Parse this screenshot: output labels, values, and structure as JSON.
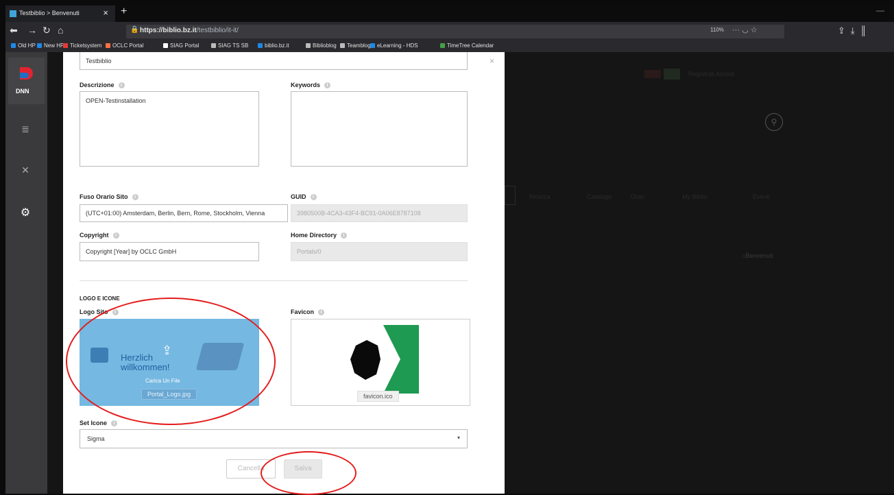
{
  "browser": {
    "tab_title": "Testbiblio > Benvenuti",
    "url_host": "https://biblio.bz.it",
    "url_path": "/testbiblio/it-it/",
    "zoom": "110%",
    "bookmarks": [
      {
        "label": "Old HP",
        "color": "#1e88e5"
      },
      {
        "label": "New HP",
        "color": "#1e88e5"
      },
      {
        "label": "Ticketsystem",
        "color": "#e53935"
      },
      {
        "label": "OCLC Portal",
        "color": "#ff7043"
      },
      {
        "label": "SIAG Portal",
        "color": "#ffffff"
      },
      {
        "label": "SIAG TS SB",
        "color": "#bbbbbb"
      },
      {
        "label": "biblio.bz.it",
        "color": "#1e88e5"
      },
      {
        "label": "Biblioblog",
        "color": "#bbbbbb"
      },
      {
        "label": "Teamblog",
        "color": "#bbbbbb"
      },
      {
        "label": "eLearning - HDS",
        "color": "#1e88e5"
      },
      {
        "label": "TimeTree Calendar",
        "color": "#43a047"
      }
    ]
  },
  "sidebar": {
    "logo_text": "DNN"
  },
  "background": {
    "user_links": "Registrati   Accedi",
    "menu": [
      "Ricerca",
      "Catalogo",
      "Orari",
      "My Biblio",
      "Eventi"
    ],
    "breadcrumb": "Benvenuti"
  },
  "form": {
    "title_value": "Testbiblio",
    "descrizione": {
      "label": "Descrizione",
      "value": "OPEN-Testinstallation"
    },
    "keywords": {
      "label": "Keywords",
      "value": ""
    },
    "fuso": {
      "label": "Fuso Orario Sito",
      "value": "(UTC+01:00) Amsterdam, Berlin, Bern, Rome, Stockholm, Vienna"
    },
    "guid": {
      "label": "GUID",
      "value": "3980500B-4CA3-43F4-BC91-0A06E8787108"
    },
    "copyright": {
      "label": "Copyright",
      "value": "Copyright [Year] by OCLC GmbH"
    },
    "home": {
      "label": "Home Directory",
      "value": "Portals/0"
    },
    "section_title": "LOGO E ICONE",
    "logo": {
      "label": "Logo Sito",
      "upload_label": "Carica Un File",
      "file": "Portal_Logo.jpg",
      "image_text_1": "Herzlich",
      "image_text_2": "willkommen!"
    },
    "favicon": {
      "label": "Favicon",
      "file": "favicon.ico"
    },
    "icon_set": {
      "label": "Set Icone",
      "value": "Sigma"
    },
    "cancel_label": "Cancella",
    "save_label": "Salva"
  }
}
